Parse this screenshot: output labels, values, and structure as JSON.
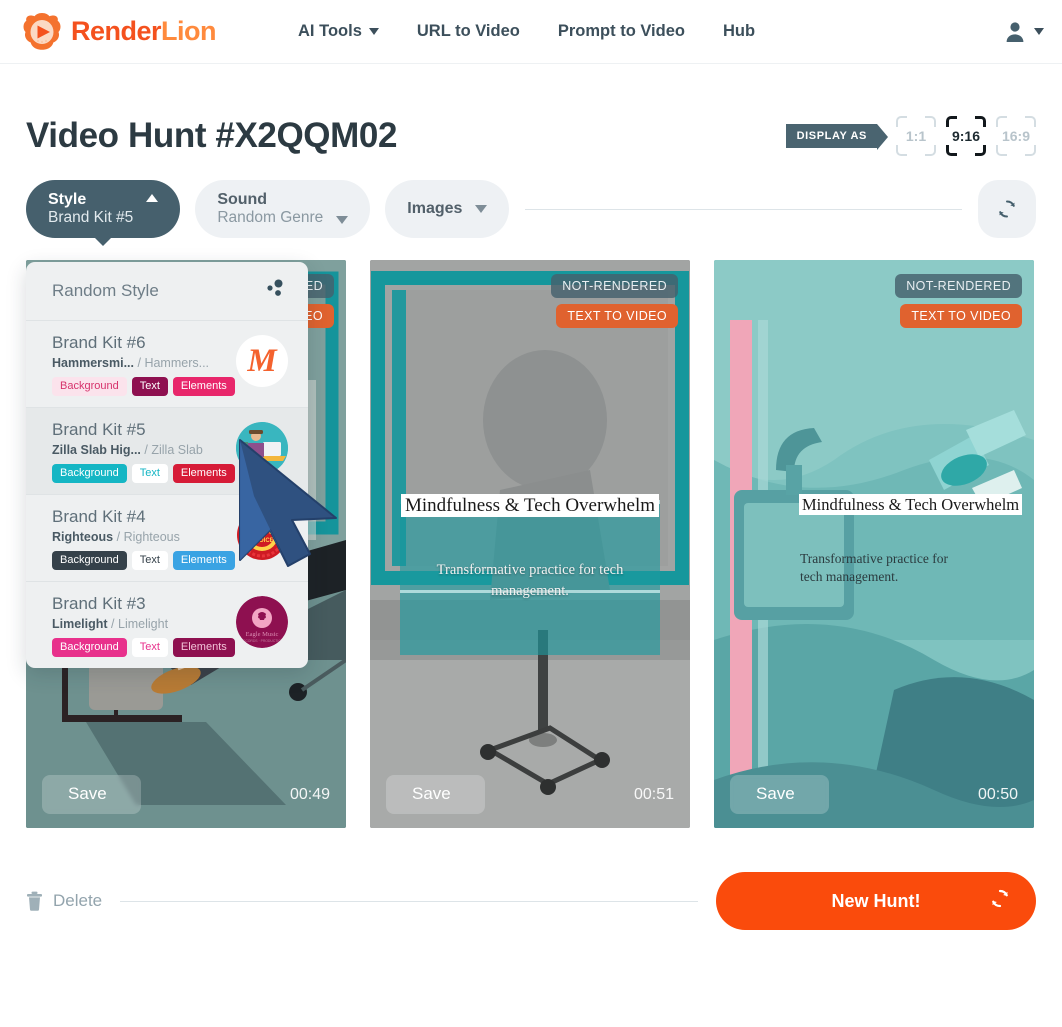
{
  "navbar": {
    "brand_first": "Render",
    "brand_second": "Lion",
    "links": [
      {
        "label": "AI Tools",
        "has_caret": true
      },
      {
        "label": "URL to Video",
        "has_caret": false
      },
      {
        "label": "Prompt to Video",
        "has_caret": false
      },
      {
        "label": "Hub",
        "has_caret": false
      }
    ],
    "account_icon": "user-icon"
  },
  "header": {
    "title": "Video Hunt #X2QQM02",
    "display_as_label": "DISPLAY AS",
    "ratios": [
      {
        "label": "1:1",
        "active": false
      },
      {
        "label": "9:16",
        "active": true
      },
      {
        "label": "16:9",
        "active": false
      }
    ]
  },
  "toolbar": {
    "style": {
      "title": "Style",
      "value": "Brand Kit #5",
      "open": true
    },
    "sound": {
      "title": "Sound",
      "value": "Random Genre",
      "open": false
    },
    "images": {
      "title": "Images"
    },
    "refresh_icon": "refresh-icon"
  },
  "dropdown": {
    "random_label": "Random Style",
    "random_icon": "dots-icon",
    "items": [
      {
        "name": "Brand Kit #6",
        "font_primary": "Hammersmi...",
        "font_sep": "/",
        "font_secondary": "Hammers...",
        "pills": [
          {
            "label": "Background",
            "bg": "#fbe3ec",
            "fg": "#d6336c"
          },
          {
            "label": "Text",
            "bg": "#8e1050",
            "fg": "#ffffff"
          },
          {
            "label": "Elements",
            "bg": "#e8276b",
            "fg": "#ffffff"
          }
        ],
        "thumb_letter": "M",
        "thumb_bg": "#ffffff",
        "thumb_fg": "#f4622e",
        "selected": false
      },
      {
        "name": "Brand Kit #5",
        "font_primary": "Zilla Slab Hig...",
        "font_sep": "/",
        "font_secondary": "Zilla Slab",
        "pills": [
          {
            "label": "Background",
            "bg": "#15b6c4",
            "fg": "#ffffff"
          },
          {
            "label": "Text",
            "bg": "#ffffff",
            "fg": "#15b6c4"
          },
          {
            "label": "Elements",
            "bg": "#d61b37",
            "fg": "#ffffff"
          }
        ],
        "thumb_letter": "",
        "thumb_bg": "#39b6bf",
        "thumb_fg": "#ffffff",
        "selected": true
      },
      {
        "name": "Brand Kit #4",
        "font_primary": "Righteous",
        "font_sep": "/",
        "font_secondary": "Righteous",
        "pills": [
          {
            "label": "Background",
            "bg": "#35414a",
            "fg": "#ffffff"
          },
          {
            "label": "Text",
            "bg": "#ffffff",
            "fg": "#35414a"
          },
          {
            "label": "Elements",
            "bg": "#3aa3e3",
            "fg": "#ffffff"
          }
        ],
        "thumb_letter": "",
        "thumb_bg": "#cf1b24",
        "thumb_fg": "#ffd24a",
        "selected": false
      },
      {
        "name": "Brand Kit #3",
        "font_primary": "Limelight",
        "font_sep": "/",
        "font_secondary": "Limelight",
        "pills": [
          {
            "label": "Background",
            "bg": "#e8318c",
            "fg": "#ffffff"
          },
          {
            "label": "Text",
            "bg": "#ffffff",
            "fg": "#e8318c"
          },
          {
            "label": "Elements",
            "bg": "#8e1050",
            "fg": "#f3c3d8"
          }
        ],
        "thumb_letter": "",
        "thumb_bg": "#8e1050",
        "thumb_fg": "#f2a6c4",
        "selected": false
      }
    ]
  },
  "cards": [
    {
      "badge_status": "NOT-RENDERED",
      "badge_type": "TEXT TO VIDEO",
      "save_label": "Save",
      "duration": "00:49",
      "title": "",
      "subtitle": ""
    },
    {
      "badge_status": "NOT-RENDERED",
      "badge_type": "TEXT TO VIDEO",
      "save_label": "Save",
      "duration": "00:51",
      "title": "Mindfulness & Tech Overwhelm",
      "subtitle": "Transformative practice for tech management."
    },
    {
      "badge_status": "NOT-RENDERED",
      "badge_type": "TEXT TO VIDEO",
      "save_label": "Save",
      "duration": "00:50",
      "title": "Mindfulness & Tech Overwhelm",
      "subtitle": "Transformative practice for tech management."
    }
  ],
  "footer": {
    "delete_label": "Delete",
    "delete_icon": "trash-icon",
    "new_hunt_label": "New Hunt!",
    "new_hunt_icon": "refresh-icon"
  },
  "colors": {
    "brand_orange": "#f4511e",
    "accent_orange": "#fa4b0c",
    "dark_slate": "#46606d",
    "teal": "#15b6c4"
  }
}
